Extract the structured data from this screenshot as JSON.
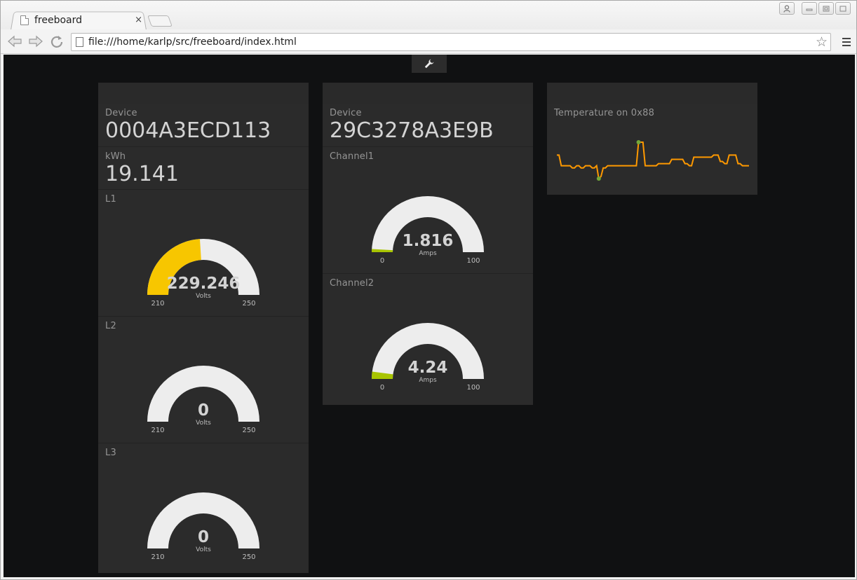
{
  "browser": {
    "tab_title": "freeboard",
    "tab_close": "×",
    "url": "file:///home/karlp/src/freeboard/index.html",
    "back_icon": "⇦",
    "forward_icon": "⇨",
    "reload_icon": "↻",
    "star_icon": "☆",
    "user_icon": "👤",
    "min_icon": "▭",
    "max_icon": "▢",
    "close_icon": "✕"
  },
  "page": {
    "settings_icon": "🔧"
  },
  "panes": {
    "p1": {
      "device_label": "Device",
      "device_value": "0004A3ECD113",
      "kwh_label": "kWh",
      "kwh_value": "19.141",
      "gauges": [
        {
          "title": "L1",
          "value": "229.246",
          "unit": "Volts",
          "min": "210",
          "max": "250",
          "fraction": 0.48,
          "fill": "#f7c600"
        },
        {
          "title": "L2",
          "value": "0",
          "unit": "Volts",
          "min": "210",
          "max": "250",
          "fraction": 0,
          "fill": "#f7c600"
        },
        {
          "title": "L3",
          "value": "0",
          "unit": "Volts",
          "min": "210",
          "max": "250",
          "fraction": 0,
          "fill": "#f7c600"
        }
      ]
    },
    "p2": {
      "device_label": "Device",
      "device_value": "29C3278A3E9B",
      "gauges": [
        {
          "title": "Channel1",
          "value": "1.816",
          "unit": "Amps",
          "min": "0",
          "max": "100",
          "fraction": 0.018,
          "fill": "#a8c400"
        },
        {
          "title": "Channel2",
          "value": "4.24",
          "unit": "Amps",
          "min": "0",
          "max": "100",
          "fraction": 0.042,
          "fill": "#a8c400"
        }
      ]
    },
    "p3": {
      "spark_title": "Temperature on 0x88",
      "series": [
        8,
        8,
        3,
        3,
        3,
        3,
        3,
        2,
        2,
        3,
        3,
        2,
        2,
        3,
        3,
        3,
        2,
        2,
        3,
        -3,
        -2,
        2,
        2,
        3,
        3,
        3,
        3,
        3,
        3,
        3,
        3,
        3,
        3,
        3,
        3,
        3,
        3,
        14,
        14,
        14,
        3,
        3,
        3,
        3,
        3,
        3,
        4,
        4,
        4,
        4,
        4,
        4,
        6,
        6,
        6,
        6,
        6,
        6,
        4,
        4,
        3,
        3,
        7,
        7,
        7,
        7,
        7,
        7,
        7,
        7,
        7,
        8,
        8,
        8,
        5,
        5,
        4,
        4,
        8,
        8,
        8,
        8,
        4,
        4,
        3,
        3,
        3,
        3
      ],
      "line_color": "#ff9900",
      "marker_color": "#73a839"
    }
  }
}
